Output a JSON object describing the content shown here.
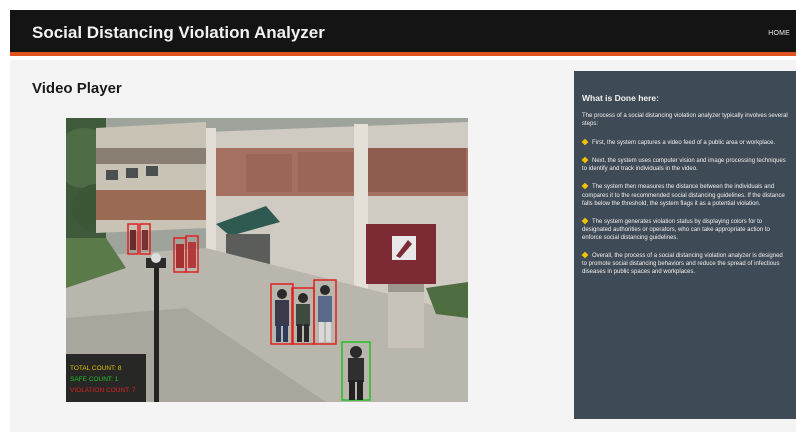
{
  "header": {
    "title": "Social Distancing Violation Analyzer",
    "nav_home": "HOME"
  },
  "main": {
    "section_title": "Video Player",
    "video_overlay": [
      "TOTAL COUNT: 8",
      "SAFE COUNT: 1",
      "VIOLATION COUNT: 7"
    ]
  },
  "sidebar": {
    "heading": "What is Done here:",
    "intro": "The process of a social distancing violation analyzer typically involves several steps:",
    "steps": [
      "First, the system captures a video feed of a public area or workplace.",
      "Next, the system uses computer vision and image processing techniques to identify and track individuals in the video.",
      "The system then measures the distance between the individuals and compares it to the recommended social distancing guidelines. If the distance falls below the threshold, the system flags it as a potential violation.",
      "The system generates violation status by displaying colors for to designated authorities or operators, who can take appropriate action to enforce social distancing guidelines.",
      "Overall, the process of a social distancing violation analyzer is designed to promote social distancing behaviors and reduce the spread of infectious diseases in public spaces and workplaces."
    ]
  },
  "colors": {
    "header_bg": "#141414",
    "accent": "#e0531c",
    "sidebar_bg": "#3e4a55",
    "violation_box": "#e02020",
    "safe_box": "#22c022",
    "bullet": "#f2c200"
  }
}
